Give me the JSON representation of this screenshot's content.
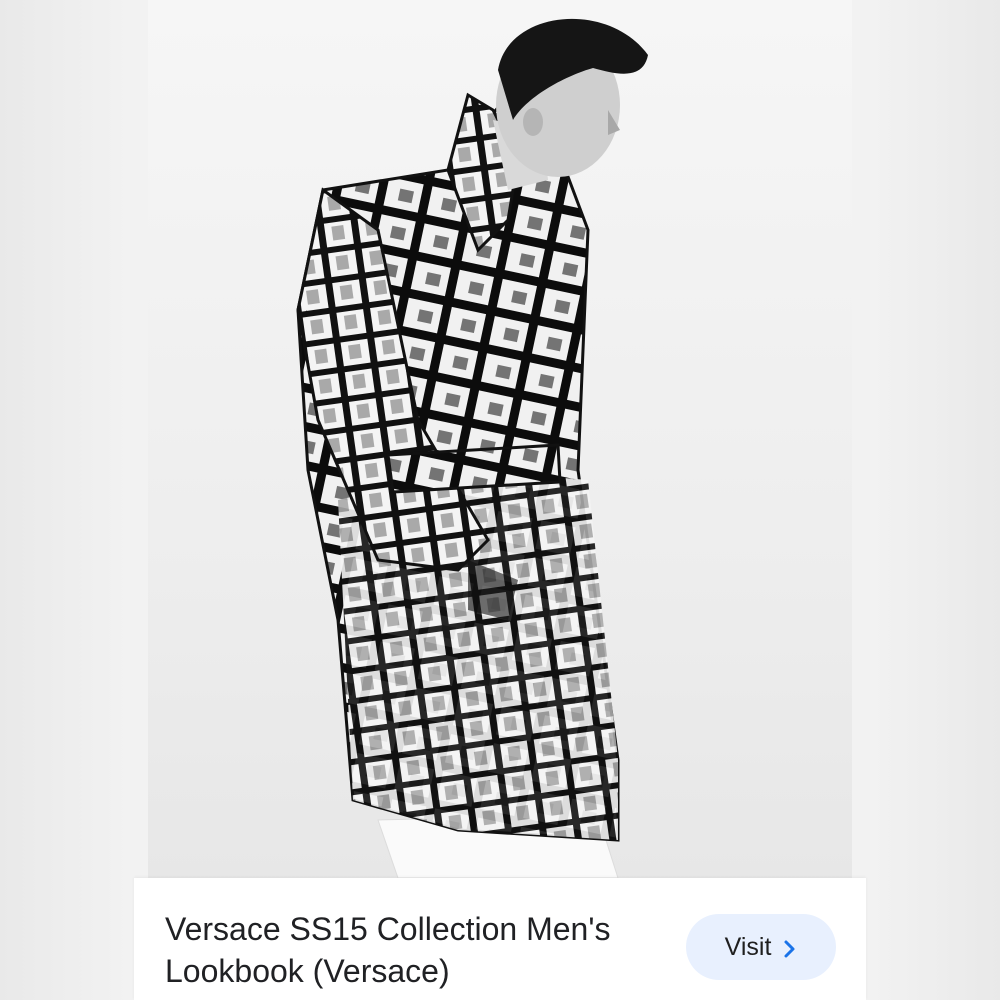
{
  "result": {
    "image": {
      "depicts": "black-and-white fashion photo of male model in abstract grid-patterned belted trench coat"
    },
    "title": "Versace SS15 Collection Men's Lookbook (Versace)",
    "visit_label": "Visit",
    "visit_icon": "chevron-right-icon",
    "accent": "#1a73e8",
    "button_bg": "#e8f0fe"
  }
}
